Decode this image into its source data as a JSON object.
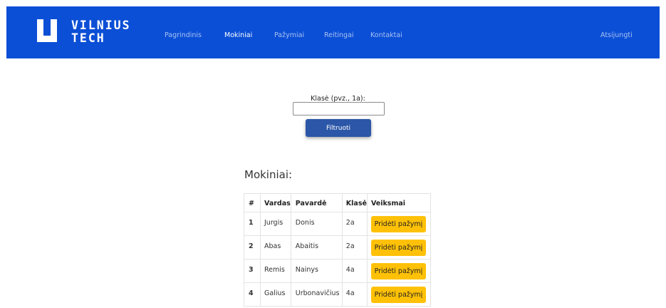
{
  "header": {
    "logo_line1": "VILNIUS",
    "logo_line2": "TECH",
    "nav": [
      {
        "label": "Pagrindinis",
        "active": false
      },
      {
        "label": "Mokiniai",
        "active": true
      },
      {
        "label": "Pažymiai",
        "active": false
      },
      {
        "label": "Reitingai",
        "active": false
      },
      {
        "label": "Kontaktai",
        "active": false
      }
    ],
    "logout_label": "Atsijungti",
    "background_color": "#0b4fd6"
  },
  "filter": {
    "label": "Klasė (pvz., 1a):",
    "input_value": "",
    "button_label": "Filtruoti"
  },
  "students": {
    "title": "Mokiniai:",
    "columns": [
      "#",
      "Vardas",
      "Pavardė",
      "Klasė",
      "Veiksmai"
    ],
    "rows": [
      {
        "num": "1",
        "first": "Jurgis",
        "last": "Donis",
        "class": "2a",
        "action": "Pridėti pažymį"
      },
      {
        "num": "2",
        "first": "Abas",
        "last": "Abaitis",
        "class": "2a",
        "action": "Pridėti pažymį"
      },
      {
        "num": "3",
        "first": "Remis",
        "last": "Nainys",
        "class": "4a",
        "action": "Pridėti pažymį"
      },
      {
        "num": "4",
        "first": "Galius",
        "last": "Urbonavičius",
        "class": "4a",
        "action": "Pridėti pažymį"
      }
    ]
  },
  "colors": {
    "primary_button": "#2c57a8",
    "action_button": "#ffc107"
  }
}
